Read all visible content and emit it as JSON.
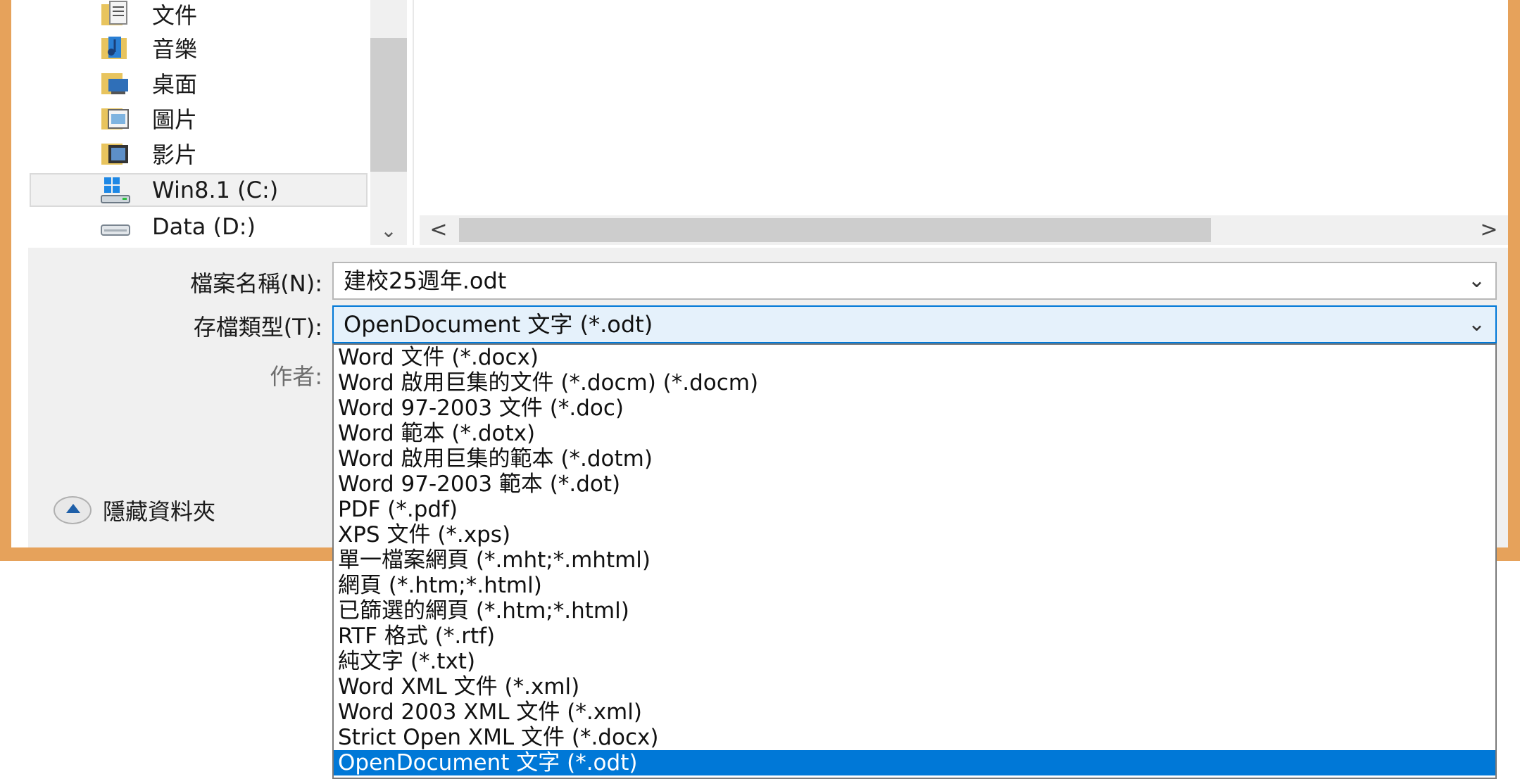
{
  "nav": {
    "items": [
      {
        "label": "文件",
        "icon": "documents-folder-icon"
      },
      {
        "label": "音樂",
        "icon": "music-folder-icon"
      },
      {
        "label": "桌面",
        "icon": "desktop-folder-icon"
      },
      {
        "label": "圖片",
        "icon": "pictures-folder-icon"
      },
      {
        "label": "影片",
        "icon": "videos-folder-icon"
      },
      {
        "label": "Win8.1 (C:)",
        "icon": "windows-drive-icon"
      },
      {
        "label": "Data (D:)",
        "icon": "drive-icon"
      }
    ],
    "selected": "Win8.1 (C:)"
  },
  "form": {
    "filename_label": "檔案名稱(N):",
    "filename_value": "建校25週年.odt",
    "filetype_label": "存檔類型(T):",
    "filetype_value": "OpenDocument 文字 (*.odt)",
    "author_label": "作者:"
  },
  "hide_folders_label": "隱藏資料夾",
  "filetype_options": [
    "Word 文件 (*.docx)",
    "Word 啟用巨集的文件 (*.docm) (*.docm)",
    "Word 97-2003 文件 (*.doc)",
    "Word 範本 (*.dotx)",
    "Word 啟用巨集的範本 (*.dotm)",
    "Word 97-2003 範本 (*.dot)",
    "PDF (*.pdf)",
    "XPS 文件 (*.xps)",
    "單一檔案網頁 (*.mht;*.mhtml)",
    "網頁 (*.htm;*.html)",
    "已篩選的網頁 (*.htm;*.html)",
    "RTF 格式 (*.rtf)",
    "純文字 (*.txt)",
    "Word XML 文件 (*.xml)",
    "Word 2003 XML 文件 (*.xml)",
    "Strict Open XML 文件 (*.docx)",
    "OpenDocument 文字 (*.odt)"
  ],
  "selected_option": "OpenDocument 文字 (*.odt)",
  "colors": {
    "frame": "#e6a25b",
    "selection": "#0078d7",
    "field_focus_bg": "#e5f1fb"
  }
}
